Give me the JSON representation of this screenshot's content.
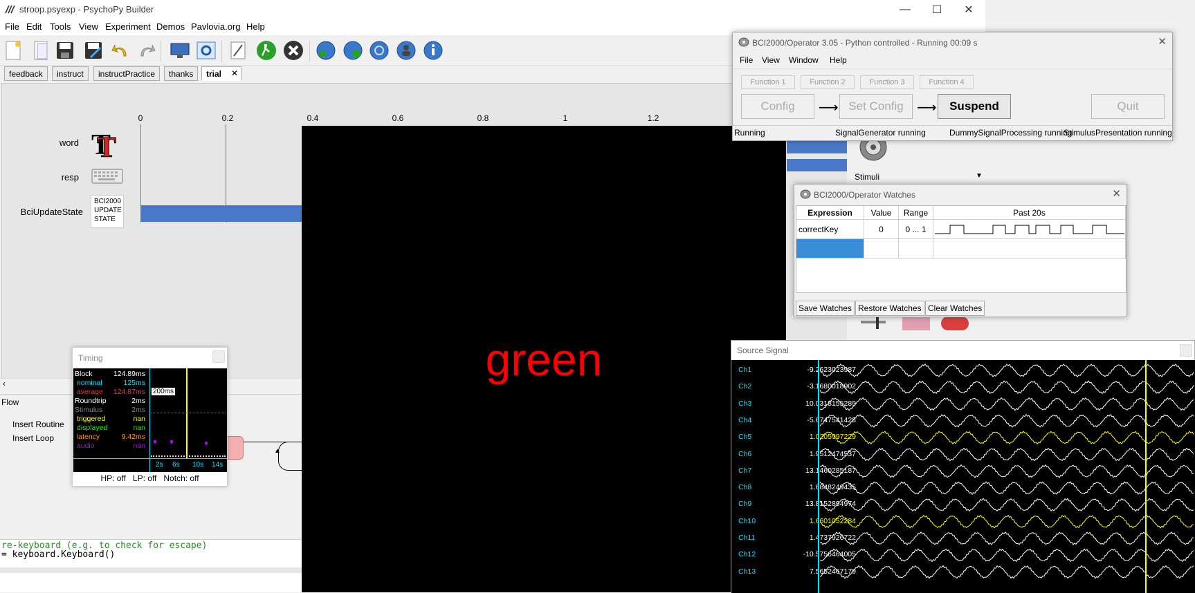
{
  "psychopy": {
    "title": "stroop.psyexp - PsychoPy Builder",
    "menu": [
      "File",
      "Edit",
      "Tools",
      "View",
      "Experiment",
      "Demos",
      "Pavlovia.org",
      "Help"
    ],
    "tabs": [
      "feedback",
      "instruct",
      "instructPractice",
      "thanks",
      "trial"
    ],
    "active_tab": "trial",
    "timeline_ticks": [
      "0",
      "0.2",
      "0.4",
      "0.6",
      "0.8",
      "1",
      "1.2"
    ],
    "components": [
      "word",
      "resp",
      "BciUpdateState"
    ],
    "bci_icon_text": [
      "BCI2000",
      "UPDATE",
      "STATE"
    ],
    "flow_label": "Flow",
    "insert_routine": "Insert Routine",
    "insert_loop": "Insert Loop",
    "code_line1": "re-keyboard (e.g. to check for escape)",
    "code_line2": "= keyboard.Keyboard()",
    "stimuli_label": "Stimuli"
  },
  "stimulus": {
    "word": "green",
    "color": "#ff0000"
  },
  "timing": {
    "title": "Timing",
    "rows": [
      {
        "label": "Block",
        "value": "124.89ms",
        "color": "#ffffff"
      },
      {
        "label": " nominal",
        "value": "125ms",
        "color": "#00e5ff"
      },
      {
        "label": " average",
        "value": "124.87ms",
        "color": "#ff3030"
      },
      {
        "label": "Roundtrip",
        "value": "2ms",
        "color": "#ffffff"
      },
      {
        "label": "Stimulus",
        "value": "2ms",
        "color": "#888888"
      },
      {
        "label": " triggered",
        "value": "nan",
        "color": "#ffff00"
      },
      {
        "label": " displayed",
        "value": "nan",
        "color": "#00ff00"
      },
      {
        "label": " latency",
        "value": "9.42ms",
        "color": "#ff9900"
      },
      {
        "label": " audio",
        "value": "nan",
        "color": "#b000ff"
      }
    ],
    "marker_label": "200ms",
    "x_ticks": [
      "2s",
      "6s",
      "10s",
      "14s"
    ],
    "footer": "HP: off   LP: off   Notch: off"
  },
  "operator": {
    "title": "BCI2000/Operator 3.05 - Python controlled - Running 00:09 s",
    "menu": [
      "File",
      "View",
      "Window",
      "Help"
    ],
    "function_buttons": [
      "Function 1",
      "Function 2",
      "Function 3",
      "Function 4"
    ],
    "config": "Config",
    "set_config": "Set Config",
    "suspend": "Suspend",
    "quit": "Quit",
    "arrow": "⟶",
    "status": [
      "Running",
      "SignalGenerator running",
      "DummySignalProcessing running",
      "StimulusPresentation running"
    ]
  },
  "watches": {
    "title": "BCI2000/Operator Watches",
    "headers": [
      "Expression",
      "Value",
      "Range",
      "Past 20s"
    ],
    "row": {
      "expression": "correctKey",
      "value": "0",
      "range": "0 ... 1"
    },
    "buttons": [
      "Save Watches",
      "Restore Watches",
      "Clear Watches"
    ]
  },
  "source": {
    "title": "Source Signal",
    "channels": [
      {
        "name": "Ch1",
        "value": "-9.2623023987",
        "color": "#ffffff"
      },
      {
        "name": "Ch2",
        "value": "-3.1680018902",
        "color": "#ffffff"
      },
      {
        "name": "Ch3",
        "value": "10.0318155289",
        "color": "#ffffff"
      },
      {
        "name": "Ch4",
        "value": "-5.6747541428",
        "color": "#ffffff"
      },
      {
        "name": "Ch5",
        "value": "1.0205997229",
        "color": "#ffff00"
      },
      {
        "name": "Ch6",
        "value": "1.9512474537",
        "color": "#ffffff"
      },
      {
        "name": "Ch7",
        "value": "13.1460285187",
        "color": "#ffffff"
      },
      {
        "name": "Ch8",
        "value": "1.6848249435",
        "color": "#ffffff"
      },
      {
        "name": "Ch9",
        "value": "13.8152894974",
        "color": "#ffffff"
      },
      {
        "name": "Ch10",
        "value": "1.6601052284",
        "color": "#ffff00"
      },
      {
        "name": "Ch11",
        "value": "1.4737926722",
        "color": "#ffffff"
      },
      {
        "name": "Ch12",
        "value": "-10.5756464005",
        "color": "#ffffff"
      },
      {
        "name": "Ch13",
        "value": "7.5652467179",
        "color": "#ffffff"
      }
    ]
  },
  "colors": {
    "accent_blue": "#4a78c8",
    "cyan": "#00e5ff",
    "yellow": "#ffff00"
  }
}
